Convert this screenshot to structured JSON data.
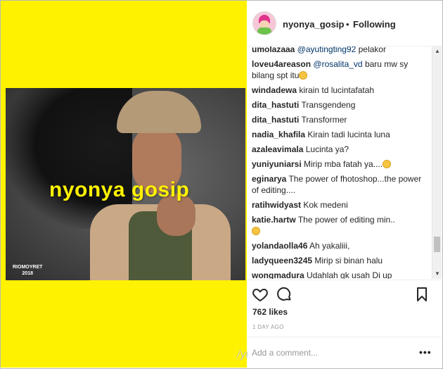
{
  "post": {
    "username": "nyonya_gosip",
    "separator": "•",
    "follow_status": "Following",
    "watermark": "nyonya gosip",
    "photo_credit_line1": "RIOMOYRET",
    "photo_credit_line2": "2018",
    "side_handle": "/yi"
  },
  "comments": [
    {
      "user": "umolazaaa",
      "mention": "@ayutingting92",
      "text": " pelakor"
    },
    {
      "user": "loveu4areason",
      "mention": "@rosalita_vd",
      "text": " baru mw sy bilang spt itu",
      "emoji": "smile"
    },
    {
      "user": "windadewa",
      "text": " kirain td lucintafatah"
    },
    {
      "user": "dita_hastuti",
      "text": " Transgendeng"
    },
    {
      "user": "dita_hastuti",
      "text": " Transformer"
    },
    {
      "user": "nadia_khafila",
      "text": " Kirain tadi lucinta luna"
    },
    {
      "user": "azaleavimala",
      "text": " Lucinta ya?"
    },
    {
      "user": "yuniyuniarsi",
      "text": " Mirip mba fatah ya....",
      "emoji": "sweat"
    },
    {
      "user": "eginarya",
      "text": " The power of fhotoshop...the power of editing...."
    },
    {
      "user": "ratihwidyast",
      "text": " Kok medeni"
    },
    {
      "user": "katie.hartw",
      "text": " The power of editing min..",
      "emoji": "smile"
    },
    {
      "user": "yolandaolla46",
      "text": " Ah yakaliii,"
    },
    {
      "user": "ladyqueen3245",
      "text": " Mirip si binan halu"
    },
    {
      "user": "wongmadura",
      "text": " Udahlah gk usah Di up"
    }
  ],
  "actions": {
    "likes": "762 likes",
    "timestamp": "1 DAY AGO",
    "comment_placeholder": "Add a comment...",
    "more_label": "•••"
  },
  "icons": [
    "heart-icon",
    "comment-icon",
    "bookmark-icon",
    "more-options-icon"
  ],
  "colors": {
    "background_yellow": "#fff200",
    "text_primary": "#262626",
    "mention": "#003569",
    "muted": "#999999"
  }
}
